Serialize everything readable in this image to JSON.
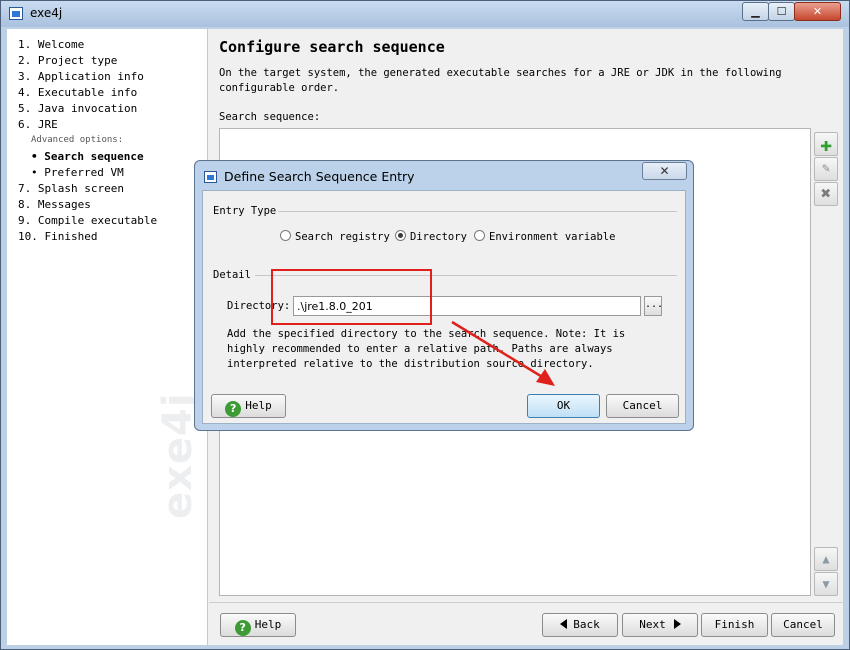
{
  "window": {
    "title": "exe4j",
    "controls": {
      "minimize": "▁",
      "maximize": "☐",
      "close": "✕"
    }
  },
  "steps": [
    {
      "label": "1. Welcome"
    },
    {
      "label": "2. Project type"
    },
    {
      "label": "3. Application info"
    },
    {
      "label": "4. Executable info"
    },
    {
      "label": "5. Java invocation"
    },
    {
      "label": "6. JRE"
    },
    {
      "label": "Advanced options:"
    },
    {
      "label": "• Search sequence"
    },
    {
      "label": "• Preferred VM"
    },
    {
      "label": "7. Splash screen"
    },
    {
      "label": "8. Messages"
    },
    {
      "label": "9. Compile executable"
    },
    {
      "label": "10. Finished"
    }
  ],
  "watermark": "exe4j",
  "page": {
    "title": "Configure search sequence",
    "description": "On the target system, the generated executable searches for a JRE or JDK in the following configurable order.",
    "list_label": "Search sequence:",
    "side_buttons": {
      "add": "add-icon",
      "edit": "edit-icon",
      "remove": "remove-icon",
      "up": "up-arrow-icon",
      "down": "down-arrow-icon"
    }
  },
  "footer": {
    "help": "Help",
    "back": "Back",
    "next": "Next",
    "finish": "Finish",
    "cancel": "Cancel"
  },
  "dialog": {
    "title": "Define Search Sequence Entry",
    "close": "✕",
    "entry_type_label": "Entry Type",
    "radios": [
      {
        "label": "Search registry",
        "selected": false
      },
      {
        "label": "Directory",
        "selected": true
      },
      {
        "label": "Environment variable",
        "selected": false
      }
    ],
    "detail_label": "Detail",
    "directory_label": "Directory:",
    "directory_value": ".\\jre1.8.0_201",
    "browse": "...",
    "note": "Add the specified directory to the search sequence. Note: It is highly recommended to enter a relative path. Paths are always interpreted relative to the distribution source directory.",
    "help": "Help",
    "ok": "OK",
    "cancel": "Cancel"
  },
  "colors": {
    "annotation": "#e0201b",
    "help_icon": "#3c9b34",
    "add_icon": "#2fa02f",
    "window_frame": "#bcd0e6"
  }
}
